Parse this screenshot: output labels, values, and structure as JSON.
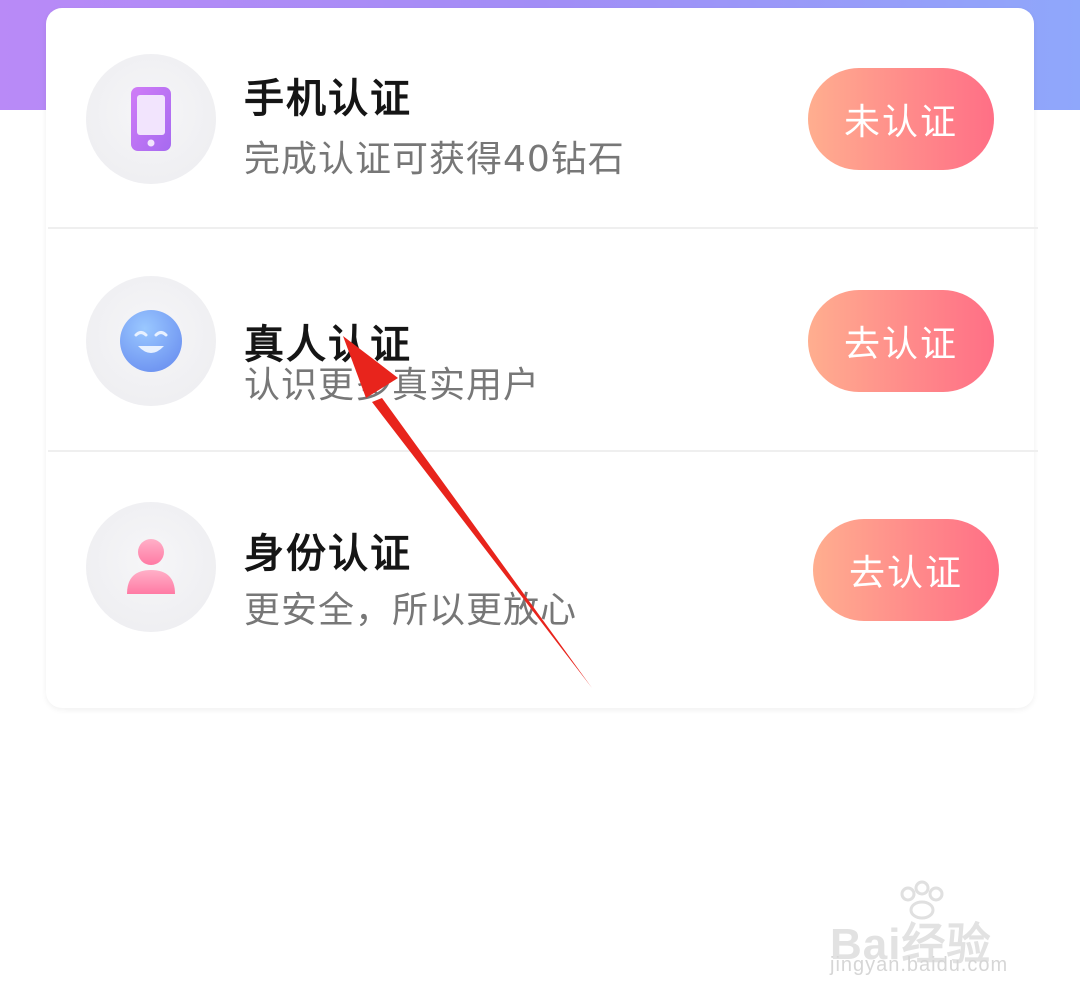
{
  "verification_list": {
    "items": [
      {
        "title": "手机认证",
        "subtitle": "完成认证可获得40钻石",
        "button_label": "未认证",
        "icon": "phone-icon"
      },
      {
        "title": "真人认证",
        "subtitle": "认识更多真实用户",
        "button_label": "去认证",
        "icon": "smile-face-icon"
      },
      {
        "title": "身份认证",
        "subtitle": "更安全，所以更放心",
        "button_label": "去认证",
        "icon": "person-icon"
      }
    ]
  },
  "colors": {
    "header_gradient": [
      "#b98af7",
      "#8fa7fb"
    ],
    "button_gradient": [
      "#ffae8f",
      "#ff6f86"
    ],
    "annotation_arrow": "#e8241c"
  },
  "watermark": {
    "brand": "Bai经验",
    "url": "jingyan.baidu.com"
  }
}
